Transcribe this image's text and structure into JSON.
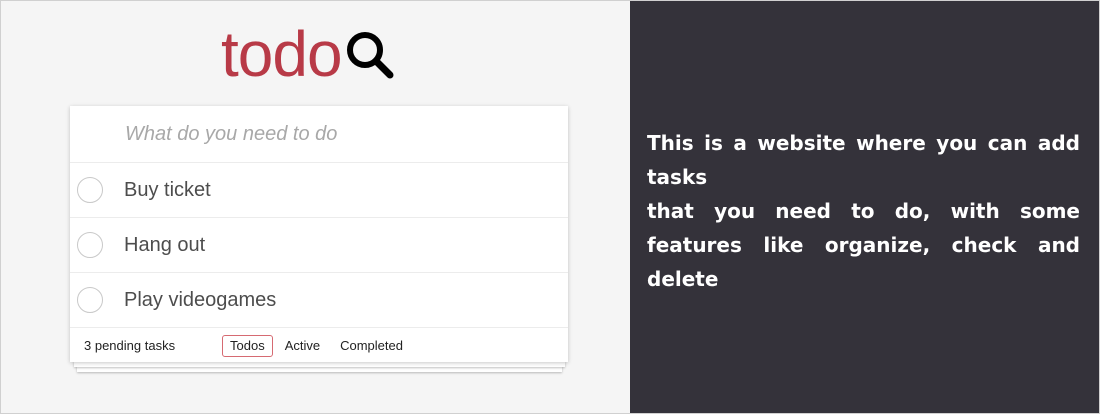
{
  "brand": {
    "logo_text": "todo",
    "logo_icon": "search-icon",
    "logo_color": "#b83a47"
  },
  "input": {
    "placeholder": "What do you need to do"
  },
  "todos": [
    {
      "label": "Buy ticket",
      "completed": false
    },
    {
      "label": "Hang out",
      "completed": false
    },
    {
      "label": "Play videogames",
      "completed": false
    }
  ],
  "footer": {
    "count_text": "3 pending tasks",
    "filters": [
      {
        "label": "Todos",
        "selected": true
      },
      {
        "label": "Active",
        "selected": false
      },
      {
        "label": "Completed",
        "selected": false
      }
    ]
  },
  "description": {
    "line1": "This is a website where you can add tasks",
    "line2": "that you need to do, with some features like organize, check and delete"
  },
  "colors": {
    "left_bg": "#f5f5f5",
    "right_bg": "#34323a",
    "accent": "#b83a47",
    "selected_filter_border": "#d66a72"
  }
}
